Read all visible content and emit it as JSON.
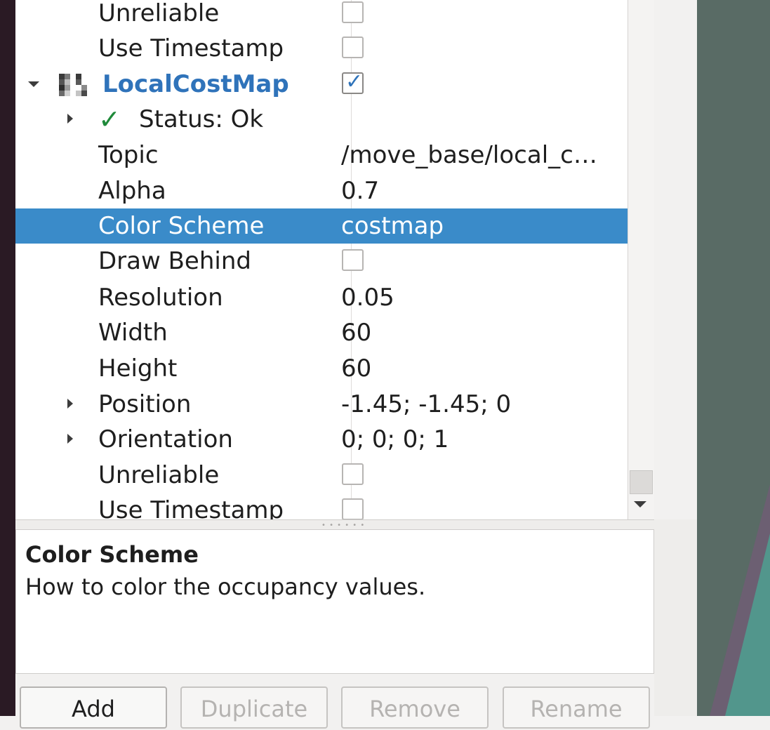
{
  "tree": {
    "rows": [
      {
        "name": "Unreliable",
        "checked": false
      },
      {
        "name": "Use Timestamp",
        "checked": false
      },
      {
        "name": "LocalCostMap",
        "checked": true
      },
      {
        "name": "Status: Ok",
        "value": ""
      },
      {
        "name": "Topic",
        "value": "/move_base/local_c…"
      },
      {
        "name": "Alpha",
        "value": "0.7"
      },
      {
        "name": "Color Scheme",
        "value": "costmap",
        "selected": true
      },
      {
        "name": "Draw Behind",
        "checked": false
      },
      {
        "name": "Resolution",
        "value": "0.05"
      },
      {
        "name": "Width",
        "value": "60"
      },
      {
        "name": "Height",
        "value": "60"
      },
      {
        "name": "Position",
        "value": "-1.45; -1.45; 0"
      },
      {
        "name": "Orientation",
        "value": "0; 0; 0; 1"
      },
      {
        "name": "Unreliable",
        "checked": false
      },
      {
        "name": "Use Timestamp",
        "checked": false
      }
    ]
  },
  "description": {
    "title": "Color Scheme",
    "text": "How to color the occupancy values."
  },
  "buttons": {
    "add": "Add",
    "duplicate": "Duplicate",
    "remove": "Remove",
    "rename": "Rename"
  },
  "colors": {
    "selection": "#3a8bc9",
    "display_name": "#2f73ba",
    "status_ok": "#1f8a3a"
  },
  "icons": {
    "status": "checkmark-icon",
    "display": "costmap-grid-icon",
    "expand": "triangle-right-icon",
    "collapse": "triangle-down-icon"
  }
}
